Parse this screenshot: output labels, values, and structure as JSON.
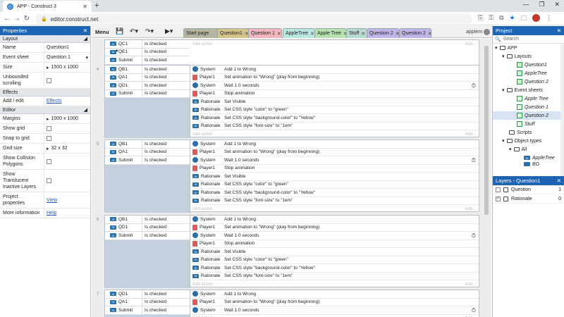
{
  "browser": {
    "tab_title": "APP - Construct 3",
    "url": "editor.construct.net"
  },
  "properties": {
    "title": "Properties",
    "sections": {
      "layout": "Layout",
      "effects": "Effects",
      "editor": "Editor"
    },
    "rows": {
      "name_label": "Name",
      "name_value": "Question1",
      "eventsheet_label": "Event sheet",
      "eventsheet_value": "Question 1",
      "size_label": "Size",
      "size_value": "1500 x 1000",
      "unbounded_label": "Unbounded scrolling",
      "addedit_label": "Add / edit",
      "addedit_value": "Effects",
      "margins_label": "Margins",
      "margins_value": "1000 x 1000",
      "showgrid_label": "Show grid",
      "snap_label": "Snap to grid",
      "gridsize_label": "Grid size",
      "gridsize_value": "32 x 32",
      "collision_label": "Show Collision Polygons",
      "translucent_label": "Show Translucent Inactive Layers",
      "projprops_label": "Project properties",
      "projprops_value": "View",
      "moreinfo_label": "More information",
      "moreinfo_value": "Help"
    }
  },
  "toolbar": {
    "menu_label": "Menu",
    "username": "applem",
    "tabs": [
      {
        "label": "Start page"
      },
      {
        "label": "Question1"
      },
      {
        "label": "Question 1"
      },
      {
        "label": "AppleTree"
      },
      {
        "label": "Apple Tree"
      },
      {
        "label": "Stuff"
      },
      {
        "label": "Question 2"
      },
      {
        "label": "Question 2"
      }
    ]
  },
  "events": {
    "e1": {
      "conds": [
        [
          "QC1",
          "Is checked"
        ],
        [
          "QE1",
          "Is checked"
        ],
        [
          "Submit",
          "Is checked"
        ]
      ],
      "add_action": "Add action"
    },
    "e2": {
      "num": "4",
      "conds": [
        [
          "QB1",
          "Is checked"
        ],
        [
          "QA1",
          "Is checked"
        ],
        [
          "QD1",
          "Is checked"
        ],
        [
          "Submit",
          "Is checked"
        ]
      ]
    },
    "e3": {
      "num": "5",
      "conds": [
        [
          "QB1",
          "Is checked"
        ],
        [
          "QA1",
          "Is checked"
        ],
        [
          "Submit",
          "Is checked"
        ]
      ]
    },
    "e4": {
      "num": "6",
      "conds": [
        [
          "QB1",
          "Is checked"
        ],
        [
          "QD1",
          "Is checked"
        ],
        [
          "Submit",
          "Is checked"
        ]
      ]
    },
    "e5": {
      "num": "7",
      "conds": [
        [
          "QD1",
          "Is checked"
        ],
        [
          "QA1",
          "Is checked"
        ],
        [
          "Submit",
          "Is checked"
        ]
      ]
    },
    "actions": [
      [
        "System",
        "Add 1 to Wrong"
      ],
      [
        "Player1",
        "Set animation to \"Wrong\" (play from beginning)"
      ],
      [
        "System",
        "Wait 1.0 seconds"
      ],
      [
        "Player1",
        "Stop animation"
      ],
      [
        "Rationale",
        "Set Visible"
      ],
      [
        "Rationale",
        "Set CSS style \"color\" to \"green\""
      ],
      [
        "Rationale",
        "Set CSS style \"background-color\" to \"Yellow\""
      ],
      [
        "Rationale",
        "Set CSS style \"font-size\" to \"1em\""
      ]
    ],
    "add_action": "Add action",
    "add_short": "Add..."
  },
  "project": {
    "title": "Project",
    "search_placeholder": "Search",
    "items": {
      "app": "APP",
      "layouts": "Layouts",
      "l1": "Question1",
      "l2": "AppleTree",
      "l3": "Question 2",
      "eventsheets": "Event sheets",
      "s1": "Apple Tree",
      "s2": "Question 1",
      "s3": "Question 2",
      "s4": "Stuff",
      "scripts": "Scripts",
      "objtypes": "Object types",
      "all": "All",
      "o1": "AppleTree",
      "o2": "BG"
    }
  },
  "layers": {
    "title": "Layers - Question1",
    "rows": [
      {
        "name": "Question",
        "index": "1"
      },
      {
        "name": "Rationale",
        "index": "0"
      }
    ]
  }
}
